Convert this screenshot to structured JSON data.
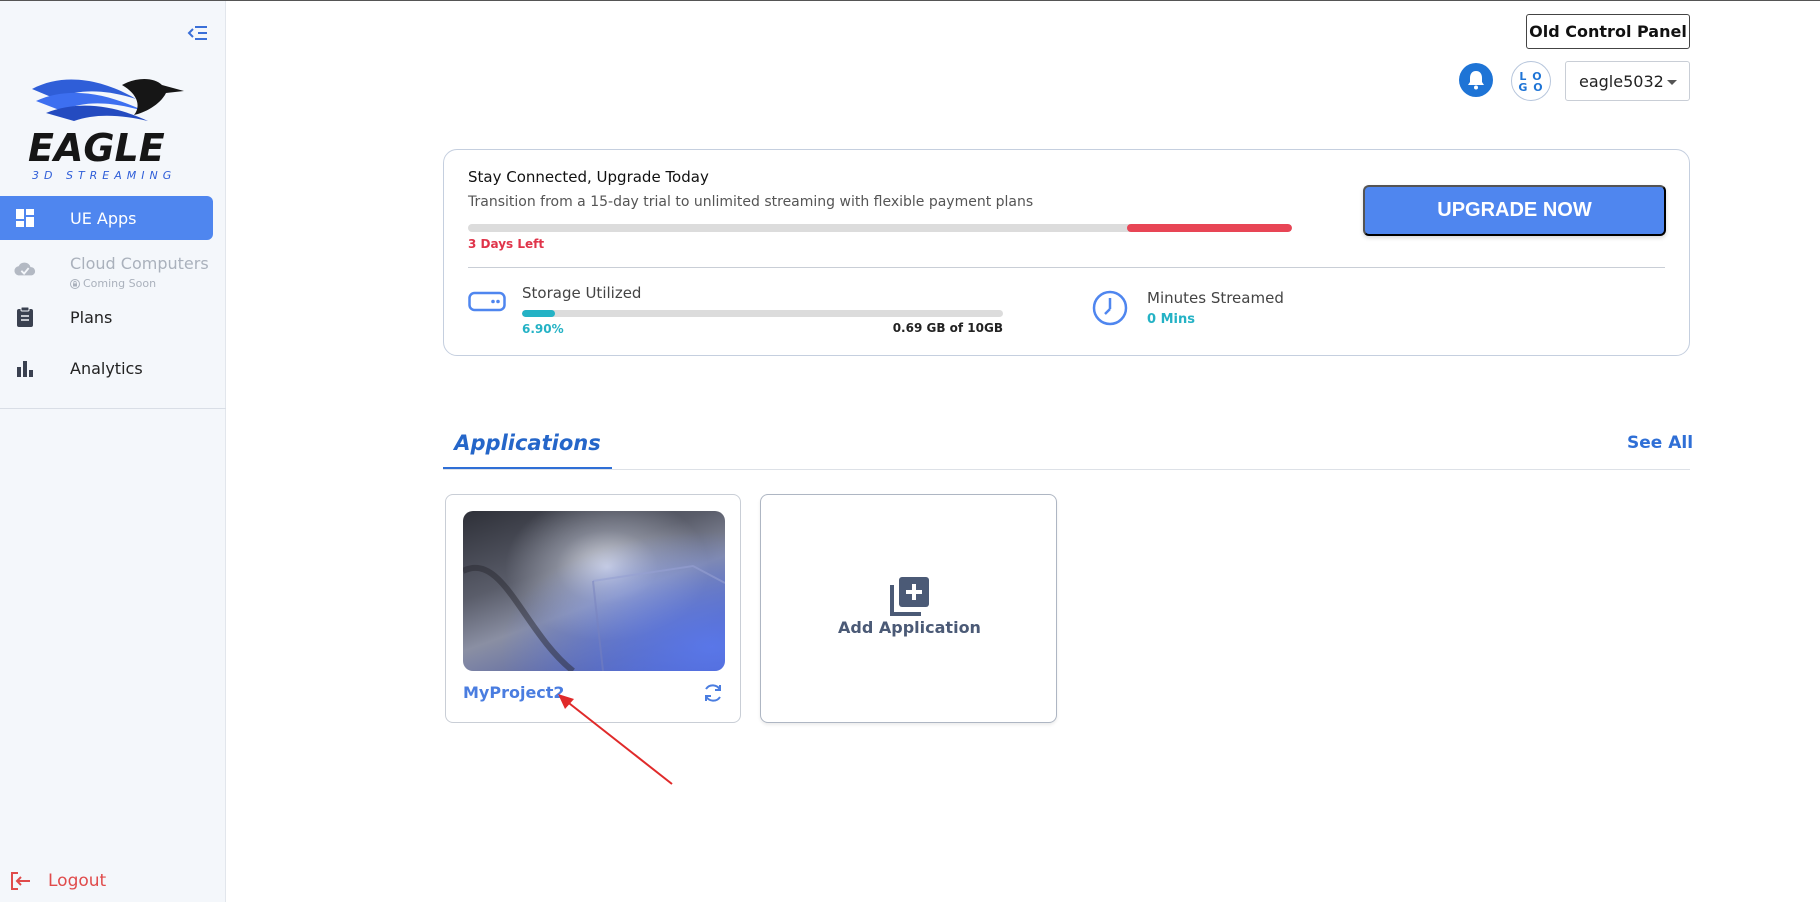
{
  "sidebar": {
    "brand": {
      "name": "EAGLE",
      "tagline": "3D STREAMING"
    },
    "items": [
      {
        "label": "UE Apps",
        "icon": "dashboard-icon",
        "active": true
      },
      {
        "label": "Cloud Computers",
        "icon": "cloud-check-icon",
        "disabled": true,
        "note": "Coming Soon"
      },
      {
        "label": "Plans",
        "icon": "clipboard-icon"
      },
      {
        "label": "Analytics",
        "icon": "bar-chart-icon"
      }
    ],
    "logout_label": "Logout"
  },
  "header": {
    "old_panel_label": "Old Control Panel",
    "avatar_text": "LOGO",
    "username": "eagle5032"
  },
  "upgrade": {
    "title": "Stay Connected, Upgrade Today",
    "subtitle": "Transition from a 15-day trial to unlimited streaming with flexible payment plans",
    "days_left": "3 Days Left",
    "days_remaining": 3,
    "trial_days": 15,
    "button_label": "UPGRADE NOW"
  },
  "usage": {
    "storage_label": "Storage Utilized",
    "storage_percent_text": "6.90%",
    "storage_percent": 6.9,
    "storage_amount": "0.69 GB of 10GB",
    "minutes_label": "Minutes Streamed",
    "minutes_value": "0 Mins"
  },
  "applications": {
    "tab_label": "Applications",
    "see_all_label": "See All",
    "apps": [
      {
        "name": "MyProject2"
      }
    ],
    "add_label": "Add Application"
  },
  "colors": {
    "accent": "#4f86ef",
    "danger": "#e84555",
    "teal": "#24b2c5",
    "sidebar_bg": "#f4f7fb"
  }
}
